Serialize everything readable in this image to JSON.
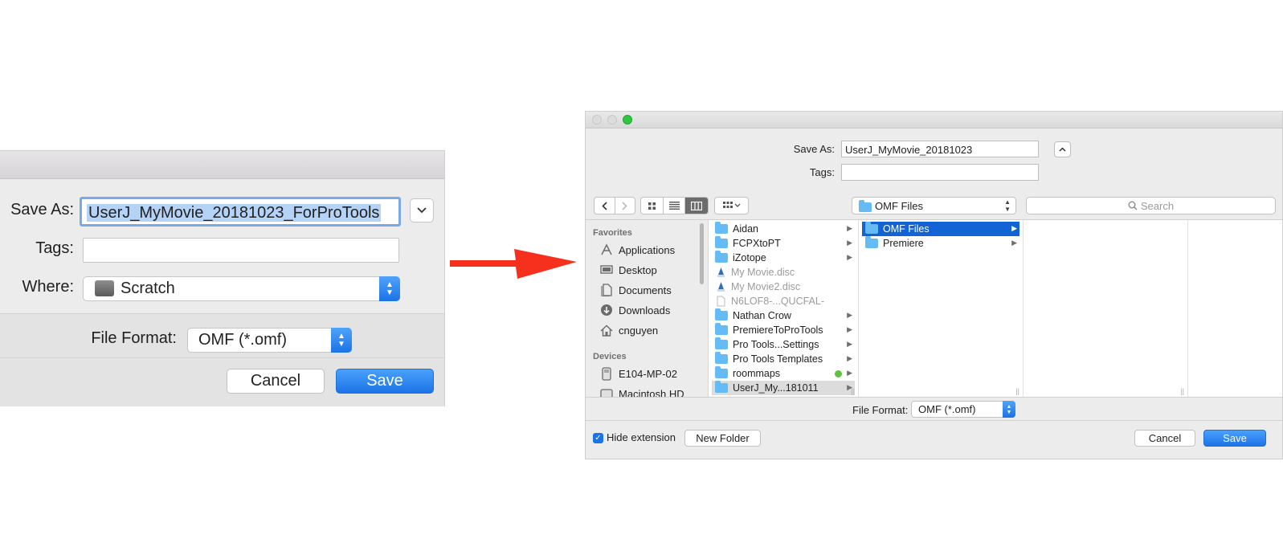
{
  "small_dialog": {
    "save_as_label": "Save As:",
    "save_as_value": "UserJ_MyMovie_20181023_ForProTools",
    "tags_label": "Tags:",
    "tags_value": "",
    "where_label": "Where:",
    "where_value": "Scratch",
    "file_format_label": "File Format:",
    "file_format_value": "OMF (*.omf)",
    "cancel_label": "Cancel",
    "save_label": "Save"
  },
  "large_dialog": {
    "save_as_label": "Save As:",
    "save_as_value": "UserJ_MyMovie_20181023",
    "tags_label": "Tags:",
    "tags_value": "",
    "location_value": "OMF Files",
    "search_placeholder": "Search",
    "sidebar": {
      "favorites_header": "Favorites",
      "favorites": [
        {
          "label": "Applications",
          "icon": "applications-icon"
        },
        {
          "label": "Desktop",
          "icon": "desktop-icon"
        },
        {
          "label": "Documents",
          "icon": "documents-icon"
        },
        {
          "label": "Downloads",
          "icon": "downloads-icon"
        },
        {
          "label": "cnguyen",
          "icon": "home-icon"
        }
      ],
      "devices_header": "Devices",
      "devices": [
        {
          "label": "E104-MP-02",
          "icon": "computer-icon"
        },
        {
          "label": "Macintosh HD",
          "icon": "disk-icon"
        }
      ]
    },
    "column1": [
      {
        "label": "Aidan",
        "kind": "folder"
      },
      {
        "label": "FCPXtoPT",
        "kind": "folder"
      },
      {
        "label": "iZotope",
        "kind": "folder"
      },
      {
        "label": "My Movie.disc",
        "kind": "disc"
      },
      {
        "label": "My Movie2.disc",
        "kind": "disc"
      },
      {
        "label": "N6LOF8-...QUCFAL-",
        "kind": "file"
      },
      {
        "label": "Nathan Crow",
        "kind": "folder"
      },
      {
        "label": "PremiereToProTools",
        "kind": "folder"
      },
      {
        "label": "Pro Tools...Settings",
        "kind": "folder"
      },
      {
        "label": "Pro Tools Templates",
        "kind": "folder"
      },
      {
        "label": "roommaps",
        "kind": "folder"
      },
      {
        "label": "UserJ_My...181011",
        "kind": "folder"
      }
    ],
    "column2": [
      {
        "label": "OMF Files",
        "kind": "folder"
      },
      {
        "label": "Premiere",
        "kind": "folder"
      }
    ],
    "file_format_label": "File Format:",
    "file_format_value": "OMF (*.omf)",
    "hide_extension_label": "Hide extension",
    "new_folder_label": "New Folder",
    "cancel_label": "Cancel",
    "save_label": "Save"
  },
  "colors": {
    "accent_blue": "#1c74e8",
    "arrow_red": "#f5301c",
    "tag_green": "#61c13e",
    "folder_blue": "#64bbf5"
  }
}
